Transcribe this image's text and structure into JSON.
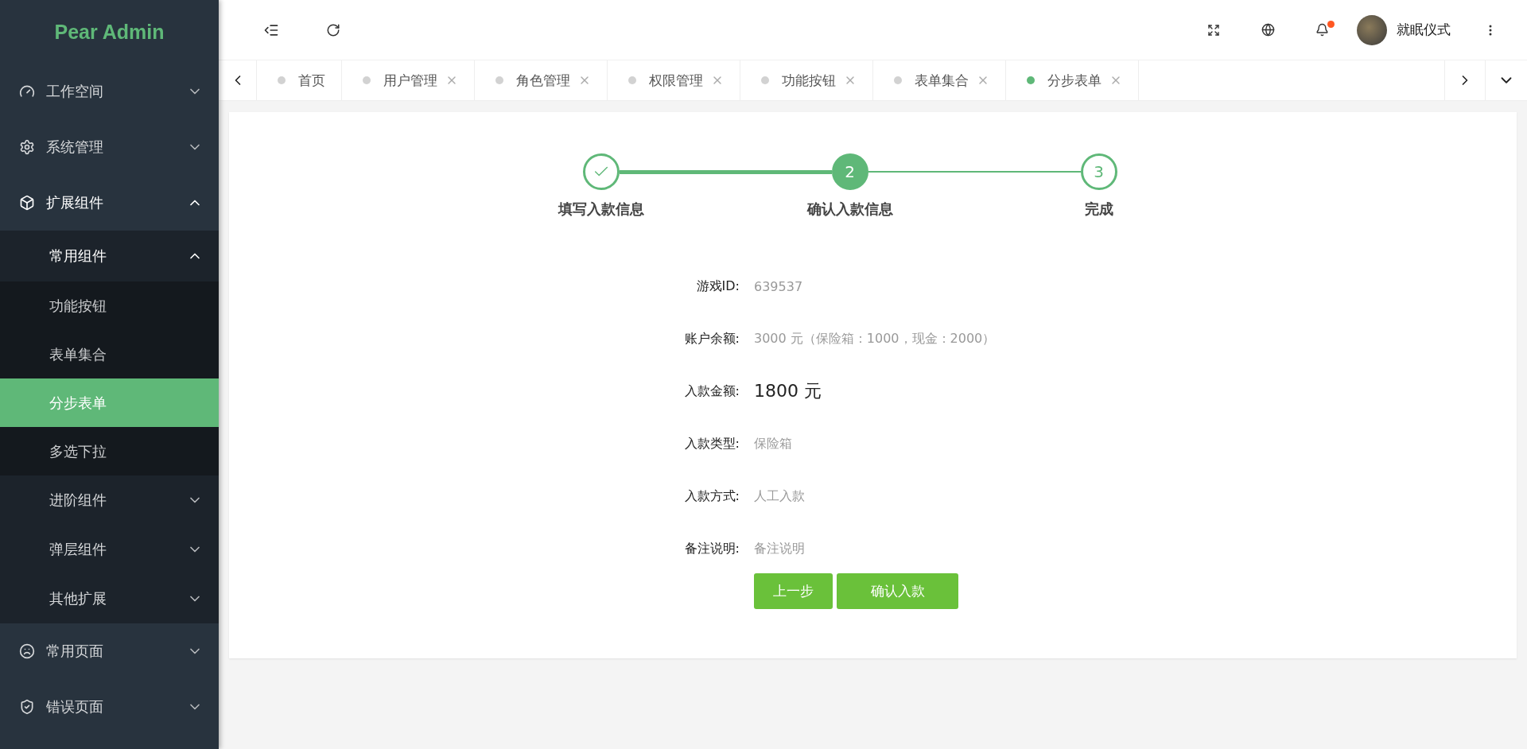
{
  "brand": "Pear Admin",
  "sidebar": {
    "items": [
      {
        "label": "工作空间",
        "expanded": false
      },
      {
        "label": "系统管理",
        "expanded": false
      },
      {
        "label": "扩展组件",
        "expanded": true,
        "children": [
          {
            "label": "常用组件",
            "expanded": true,
            "children": [
              {
                "label": "功能按钮",
                "selected": false
              },
              {
                "label": "表单集合",
                "selected": false
              },
              {
                "label": "分步表单",
                "selected": true
              },
              {
                "label": "多选下拉",
                "selected": false
              }
            ]
          },
          {
            "label": "进阶组件",
            "expanded": false
          },
          {
            "label": "弹层组件",
            "expanded": false
          },
          {
            "label": "其他扩展",
            "expanded": false
          }
        ]
      },
      {
        "label": "常用页面",
        "expanded": false
      },
      {
        "label": "错误页面",
        "expanded": false
      }
    ]
  },
  "header": {
    "user": "就眠仪式",
    "notification": true
  },
  "tabs": [
    {
      "label": "首页",
      "selected": false,
      "closable": false
    },
    {
      "label": "用户管理",
      "selected": false,
      "closable": true
    },
    {
      "label": "角色管理",
      "selected": false,
      "closable": true
    },
    {
      "label": "权限管理",
      "selected": false,
      "closable": true
    },
    {
      "label": "功能按钮",
      "selected": false,
      "closable": true
    },
    {
      "label": "表单集合",
      "selected": false,
      "closable": true
    },
    {
      "label": "分步表单",
      "selected": true,
      "closable": true
    }
  ],
  "steps": [
    {
      "label": "填写入款信息",
      "kind": "done"
    },
    {
      "label": "确认入款信息",
      "number": "2",
      "kind": "current"
    },
    {
      "label": "完成",
      "number": "3",
      "kind": "todo"
    }
  ],
  "form": {
    "rows": [
      {
        "label": "游戏ID:",
        "value": "639537",
        "kind": "plain"
      },
      {
        "label": "账户余额:",
        "value": "3000 元（保险箱：1000，现金：2000）",
        "kind": "plain"
      },
      {
        "label": "入款金额:",
        "value": "1800 元",
        "kind": "emphasis"
      },
      {
        "label": "入款类型:",
        "value": "保险箱",
        "kind": "plain"
      },
      {
        "label": "入款方式:",
        "value": "人工入款",
        "kind": "plain"
      },
      {
        "label": "备注说明:",
        "value": "备注说明",
        "kind": "plain"
      }
    ],
    "buttons": [
      "上一步",
      "确认入款"
    ]
  }
}
